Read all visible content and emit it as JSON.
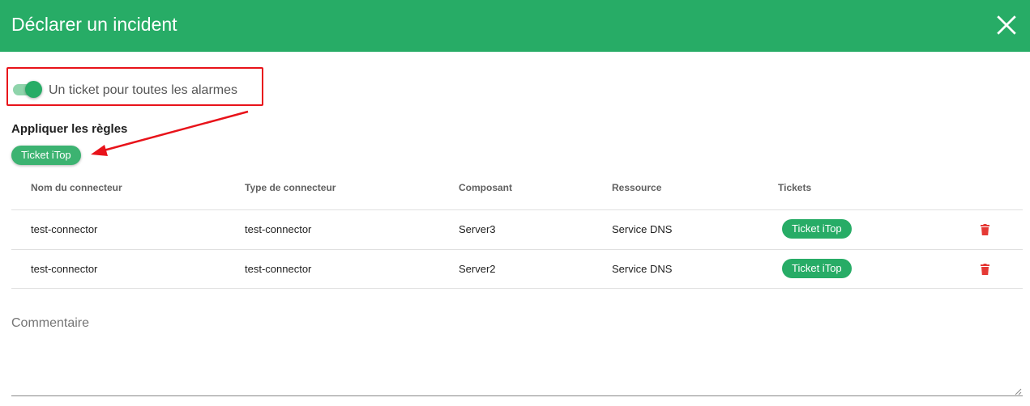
{
  "dialog": {
    "title": "Déclarer un incident",
    "close_icon": "close-icon"
  },
  "toggle": {
    "label": "Un ticket pour toutes les alarmes",
    "checked": true
  },
  "rules": {
    "title": "Appliquer les règles",
    "chip_label": "Ticket iTop"
  },
  "table": {
    "headers": [
      "Nom du connecteur",
      "Type de connecteur",
      "Composant",
      "Ressource",
      "Tickets"
    ],
    "rows": [
      {
        "name": "test-connector",
        "type": "test-connector",
        "component": "Server3",
        "resource": "Service DNS",
        "ticket": "Ticket iTop"
      },
      {
        "name": "test-connector",
        "type": "test-connector",
        "component": "Server2",
        "resource": "Service DNS",
        "ticket": "Ticket iTop"
      }
    ]
  },
  "comment": {
    "label": "Commentaire",
    "value": ""
  },
  "colors": {
    "primary": "#27ac66",
    "annotation": "#e8131a",
    "delete": "#e53935"
  }
}
